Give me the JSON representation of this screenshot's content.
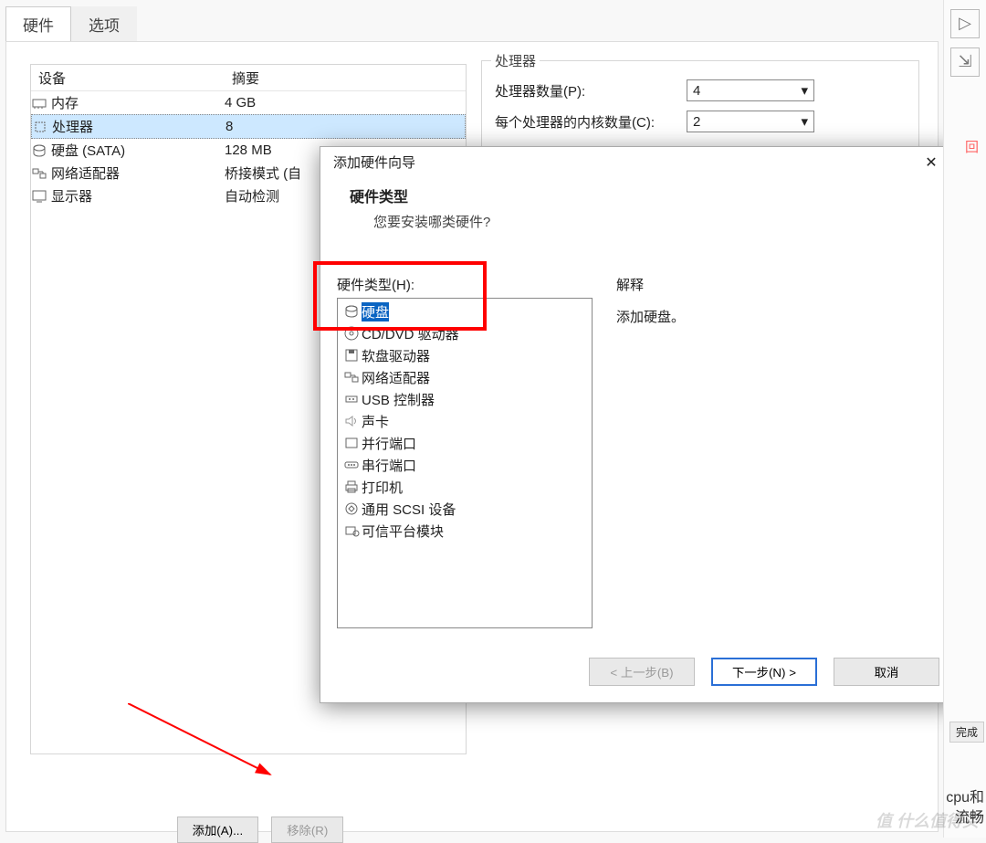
{
  "tabs": [
    "硬件",
    "选项"
  ],
  "cols": [
    "设备",
    "摘要"
  ],
  "devices": [
    {
      "name": "内存",
      "summary": "4 GB",
      "icon": "ram"
    },
    {
      "name": "处理器",
      "summary": "8",
      "icon": "cpu",
      "selected": true
    },
    {
      "name": "硬盘 (SATA)",
      "summary": "128 MB",
      "icon": "disk"
    },
    {
      "name": "网络适配器",
      "summary": "桥接模式 (自",
      "icon": "net"
    },
    {
      "name": "显示器",
      "summary": "自动检测",
      "icon": "display"
    }
  ],
  "right": {
    "legend": "处理器",
    "row1": "处理器数量(P):",
    "val1": "4",
    "row2": "每个处理器的内核数量(C):",
    "val2": "2"
  },
  "add_btn": "添加(A)...",
  "remove_btn": "移除(R)",
  "modal": {
    "title": "添加硬件向导",
    "heading": "硬件类型",
    "question": "您要安装哪类硬件?",
    "list_label": "硬件类型(H):",
    "items": [
      {
        "label": "硬盘",
        "icon": "disk",
        "selected": true
      },
      {
        "label": "CD/DVD 驱动器",
        "icon": "cd"
      },
      {
        "label": "软盘驱动器",
        "icon": "floppy"
      },
      {
        "label": "网络适配器",
        "icon": "net"
      },
      {
        "label": "USB 控制器",
        "icon": "usb"
      },
      {
        "label": "声卡",
        "icon": "sound"
      },
      {
        "label": "并行端口",
        "icon": "port"
      },
      {
        "label": "串行端口",
        "icon": "serial"
      },
      {
        "label": "打印机",
        "icon": "printer"
      },
      {
        "label": "通用 SCSI 设备",
        "icon": "scsi"
      },
      {
        "label": "可信平台模块",
        "icon": "tpm"
      }
    ],
    "explain_label": "解释",
    "explain_text": "添加硬盘。",
    "back": "< 上一步(B)",
    "next": "下一步(N) >",
    "cancel": "取消"
  },
  "side_text": {
    "a": "回",
    "b": "cpu和",
    "c": "流畅",
    "d": "完成"
  },
  "watermark": "值 什么值得买"
}
